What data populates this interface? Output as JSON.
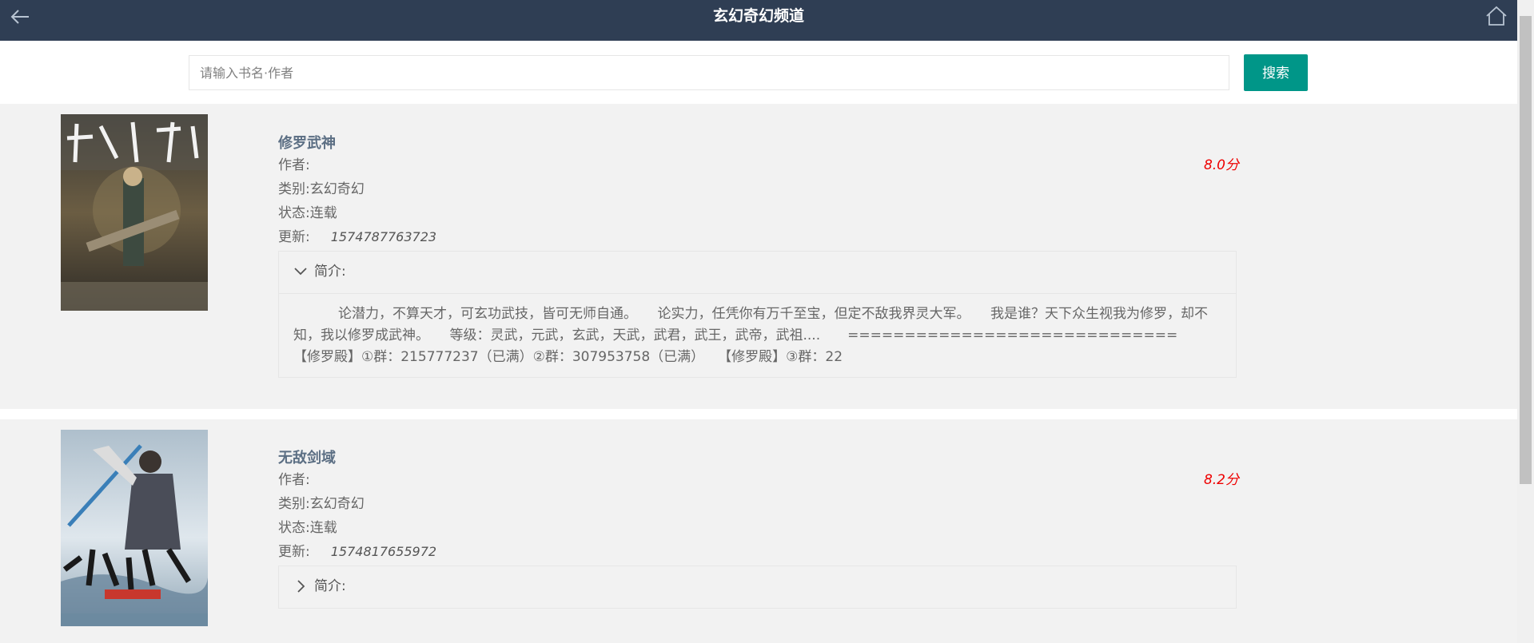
{
  "header": {
    "title": "玄幻奇幻频道",
    "back_icon": "arrow-left-icon",
    "home_icon": "home-icon"
  },
  "search": {
    "placeholder": "请输入书名·作者",
    "value": "",
    "button_label": "搜索",
    "button_color": "#009688"
  },
  "colors": {
    "header_bg": "#2f3e54",
    "score": "#ee0000",
    "title": "#5c6f84"
  },
  "books": [
    {
      "title": "修罗武神",
      "author_label": "作者:",
      "author": "",
      "score": "8.0分",
      "category_label": "类别:",
      "category": "玄幻奇幻",
      "status_label": "状态:",
      "status": "连载",
      "update_label": "更新:",
      "update": "1574787763723",
      "intro_label": "简介:",
      "intro_expanded": true,
      "intro": "论潜力，不算天才，可玄功武技，皆可无师自通。　　论实力，任凭你有万千至宝，但定不敌我界灵大军。　　我是谁？天下众生视我为修罗，却不知，我以修罗成武神。　　等级：灵武，元武，玄武，天武，武君，武王，武帝，武祖....　　=============================　　【修罗殿】①群：215777237（已满）②群：307953758（已满）　　【修罗殿】③群：22"
    },
    {
      "title": "无敌剑域",
      "author_label": "作者:",
      "author": "",
      "score": "8.2分",
      "category_label": "类别:",
      "category": "玄幻奇幻",
      "status_label": "状态:",
      "status": "连载",
      "update_label": "更新:",
      "update": "1574817655972",
      "intro_label": "简介:",
      "intro_expanded": false,
      "intro": ""
    }
  ]
}
